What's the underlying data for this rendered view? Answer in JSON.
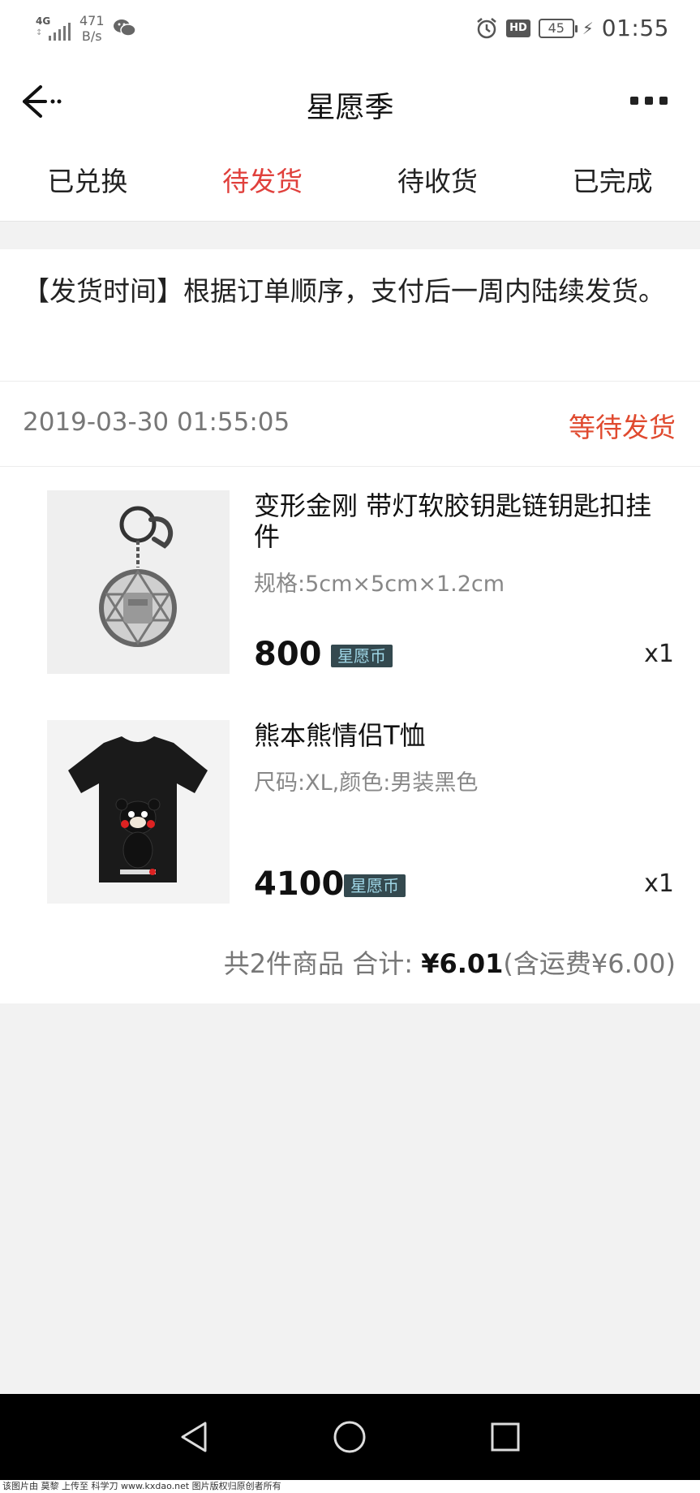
{
  "status_bar": {
    "network": "4G",
    "speed_value": "471",
    "speed_unit": "B/s",
    "battery": "45",
    "hd_label": "HD",
    "time": "01:55"
  },
  "nav": {
    "title": "星愿季"
  },
  "tabs": [
    {
      "label": "已兑换",
      "active": false
    },
    {
      "label": "待发货",
      "active": true
    },
    {
      "label": "待收货",
      "active": false
    },
    {
      "label": "已完成",
      "active": false
    }
  ],
  "notice": "【发货时间】根据订单顺序，支付后一周内陆续发货。",
  "order": {
    "date": "2019-03-30 01:55:05",
    "status": "等待发货",
    "items": [
      {
        "title": "变形金刚 带灯软胶钥匙链钥匙扣挂件",
        "spec": "规格:5cm×5cm×1.2cm",
        "price": "800",
        "currency": "星愿币",
        "qty": "x1",
        "image": "keychain-image"
      },
      {
        "title": "熊本熊情侣T恤",
        "spec": "尺码:XL,颜色:男装黑色",
        "price": "4100",
        "currency": "星愿币",
        "qty": "x1",
        "image": "tshirt-image"
      }
    ],
    "summary_prefix": "共2件商品 合计: ",
    "summary_total": "¥6.01",
    "summary_suffix": "(含运费¥6.00)"
  },
  "watermark": "该图片由 莫黎 上传至 科学刀 www.kxdao.net 图片版权归原创者所有",
  "colors": {
    "accent": "#e0403c",
    "coin_badge_bg": "#34494f",
    "coin_badge_text": "#9fd6e6"
  }
}
